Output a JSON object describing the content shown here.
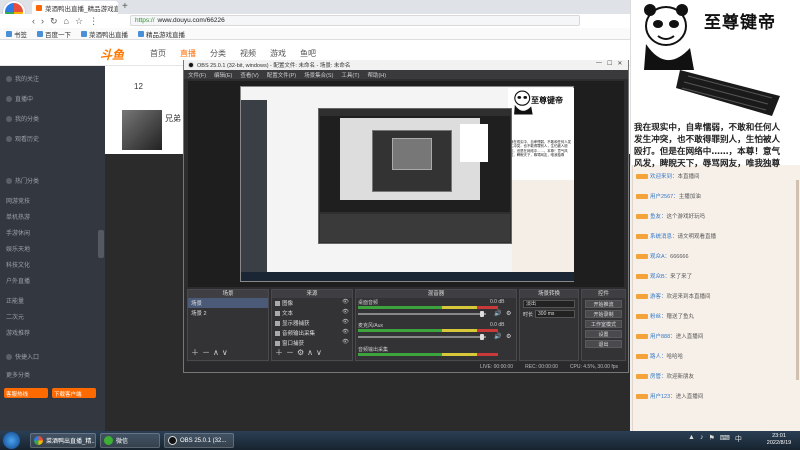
{
  "browser": {
    "tab_title": "菜酒鸭出直播_精品游戏直播",
    "tab_close": "×",
    "new_tab": "+",
    "nav_back": "‹",
    "nav_forward": "›",
    "nav_refresh": "↻",
    "nav_home": "⌂",
    "nav_bookmark": "☆",
    "nav_menu": "⋮",
    "url_protocol": "https://",
    "url": "www.douyu.com/66226",
    "bookmarks": [
      "书签",
      "百度一下",
      "菜酒鸭出直播",
      "精品游戏直播"
    ]
  },
  "site": {
    "logo": "斗鱼",
    "nav": [
      "首页",
      "直播",
      "分类",
      "视频",
      "游戏",
      "鱼吧"
    ],
    "viewer_count": "12",
    "streamer_name": "兄弟",
    "sidebar_items": [
      "我的关注",
      "直播中",
      "我的分类",
      "观看历史",
      "热门分类",
      "网游竞技",
      "单机热游",
      "手游休闲",
      "娱乐天地",
      "科技文化",
      "户外直播",
      "正能量",
      "二次元",
      "游戏推荐",
      "快捷入口",
      "更多分类"
    ],
    "sidebar_hotline": "客服热线",
    "sidebar_download": "下载客户端"
  },
  "meme": {
    "title": "至尊键帝",
    "lines": [
      "我在现实中，自卑懦弱，不敢和任何人",
      "发生冲突，也不敢得罪别人，生怕被人",
      "殴打。但是在网络中……，本尊！意气",
      "风发，睥睨天下，辱骂网友，唯我独尊"
    ]
  },
  "chat": {
    "lines": [
      {
        "user": "欢迎来到",
        "text": "本直播间"
      },
      {
        "user": "用户2567",
        "text": "主播加油"
      },
      {
        "user": "鱼友",
        "text": "这个游戏好玩吗"
      },
      {
        "user": "系统消息",
        "text": "请文明观看直播"
      },
      {
        "user": "观众A",
        "text": "666666"
      },
      {
        "user": "观众B",
        "text": "来了来了"
      },
      {
        "user": "游客",
        "text": "欢迎来到本直播间"
      },
      {
        "user": "粉丝",
        "text": "赠送了鱼丸"
      },
      {
        "user": "用户888",
        "text": "进入直播间"
      },
      {
        "user": "路人",
        "text": "哈哈哈"
      },
      {
        "user": "房管",
        "text": "欢迎新朋友"
      },
      {
        "user": "用户123",
        "text": "进入直播间"
      }
    ]
  },
  "obs": {
    "title": "OBS 25.0.1 (32-bit, windows) - 配置文件: 未命名 - 场景: 未命名",
    "win_min": "—",
    "win_max": "☐",
    "win_close": "✕",
    "menu": [
      "文件(F)",
      "编辑(E)",
      "查看(V)",
      "配置文件(P)",
      "场景集合(S)",
      "工具(T)",
      "帮助(H)"
    ],
    "nested_meme_title": "至尊键帝",
    "nested_meme_text": "我在现实中，自卑懦弱，不敢和任何人发生冲突，也不敢得罪别人，生怕被人殴打。但是在网络中……，本尊！意气风发，睥睨天下，辱骂网友，唯我独尊",
    "docks": {
      "scenes_title": "场景",
      "scenes": [
        "场景",
        "场景 2"
      ],
      "sources_title": "来源",
      "sources": [
        "图像",
        "文本",
        "显示器捕获",
        "音频输出采集",
        "窗口捕获"
      ],
      "mixer_title": "混音器",
      "mixer": [
        {
          "name": "桌面音频",
          "db": "0.0 dB"
        },
        {
          "name": "麦克风/Aux",
          "db": "0.0 dB"
        },
        {
          "name": "音频输出采集",
          "db": "0.0 dB"
        }
      ],
      "transitions_title": "场景转换",
      "transition_type": "淡出",
      "duration_label": "时长",
      "duration_value": "300 ms",
      "controls_title": "控件",
      "controls": [
        "开始推流",
        "开始录制",
        "工作室模式",
        "设置",
        "退出"
      ]
    },
    "status": {
      "live": "LIVE: 00:00:00",
      "rec": "REC: 00:00:00",
      "cpu": "CPU: 4.5%, 30.00 fps"
    }
  },
  "taskbar": {
    "tasks": [
      "菜酒鸭出直播_精...",
      "微信",
      "OBS 25.0.1 (32..."
    ],
    "tray": [
      "▲",
      "♪",
      "⚑",
      "⌨",
      "中"
    ],
    "time": "23:01",
    "date": "2022/8/19"
  }
}
